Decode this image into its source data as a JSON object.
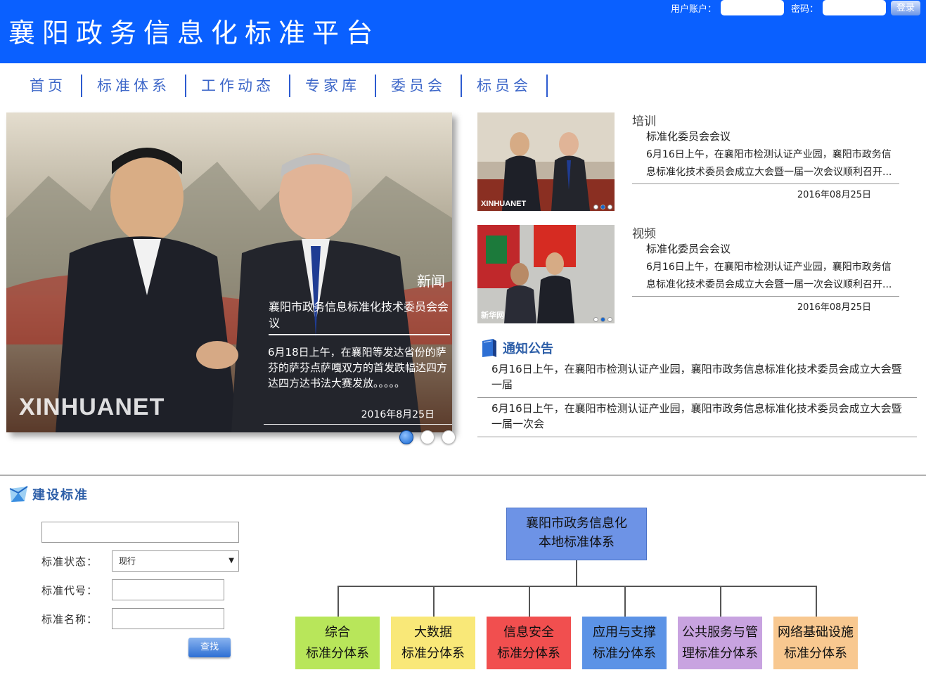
{
  "header": {
    "title": "襄阳政务信息化标准平台",
    "user_label": "用户账户：",
    "password_label": "密码：",
    "login_button": "登录"
  },
  "nav": {
    "items": [
      {
        "label": "首页"
      },
      {
        "label": "标准体系"
      },
      {
        "label": "工作动态"
      },
      {
        "label": "专家库"
      },
      {
        "label": "委员会"
      },
      {
        "label": "标员会"
      }
    ]
  },
  "banner": {
    "category": "新闻",
    "title": "襄阳市政务信息标准化技术委员会会议",
    "description": "6月18日上午，在襄阳等发达省份的萨芬的萨芬点萨嘎双方的首发跌幅达四方达四方达书法大赛发放。。。。。",
    "date": "2016年8月25日",
    "watermark": "XINHUANET",
    "slide_count": 3,
    "active_slide": 1
  },
  "cards": [
    {
      "category": "培训",
      "title": "标准化委员会会议",
      "description": "6月16日上午，在襄阳市检测认证产业园，襄阳市政务信息标准化技术委员会成立大会暨一届一次会议顺利召开...",
      "date": "2016年08月25日",
      "watermark": "XINHUANET"
    },
    {
      "category": "视频",
      "title": "标准化委员会会议",
      "description": "6月16日上午，在襄阳市检测认证产业园，襄阳市政务信息标准化技术委员会成立大会暨一届一次会议顺利召开...",
      "date": "2016年08月25日",
      "watermark": "新华网"
    }
  ],
  "notice": {
    "title": "通知公告",
    "items": [
      "6月16日上午，在襄阳市检测认证产业园，襄阳市政务信息标准化技术委员会成立大会暨一届",
      "6月16日上午，在襄阳市检测认证产业园，襄阳市政务信息标准化技术委员会成立大会暨一届一次会"
    ]
  },
  "build": {
    "title": "建设标准",
    "keyword_value": "",
    "status_label": "标准状态：",
    "status_value": "现行",
    "code_label": "标准代号：",
    "name_label": "标准名称：",
    "query_button": "查找"
  },
  "diagram": {
    "root": "襄阳市政务信息化本地标准体系",
    "root_lines": [
      "襄阳市政务信息化",
      "本地标准体系"
    ],
    "children": [
      {
        "lines": [
          "综合",
          "标准分体系"
        ],
        "color": "#b8e65a"
      },
      {
        "lines": [
          "大数据",
          "标准分体系"
        ],
        "color": "#f9e878"
      },
      {
        "lines": [
          "信息安全",
          "标准分体系"
        ],
        "color": "#f14f4f"
      },
      {
        "lines": [
          "应用与支撑",
          "标准分体系"
        ],
        "color": "#5c93e6"
      },
      {
        "lines": [
          "公共服务与管",
          "理标准分体系"
        ],
        "color": "#c8a3e0"
      },
      {
        "lines": [
          "网络基础设施",
          "标准分体系"
        ],
        "color": "#f8c890"
      }
    ]
  }
}
